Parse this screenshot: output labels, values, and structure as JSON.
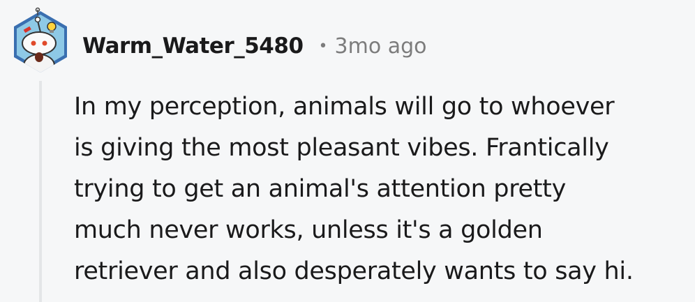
{
  "comment": {
    "author": "Warm_Water_5480",
    "separator": "•",
    "timestamp": "3mo ago",
    "body_lines": [
      "In my perception, animals will go to whoever",
      "is giving the most pleasant vibes. Frantically",
      "trying to get an animal's attention pretty",
      "much never works, unless it's a golden",
      "retriever and also desperately wants to say hi."
    ],
    "avatar_icon": "snoo-avatar-icon"
  },
  "colors": {
    "background": "#f6f7f8",
    "text": "#1a1a1b",
    "meta": "#7c7c7c",
    "avatar_border": "#3a6fb0",
    "thread_line": "#e4e6e8"
  }
}
